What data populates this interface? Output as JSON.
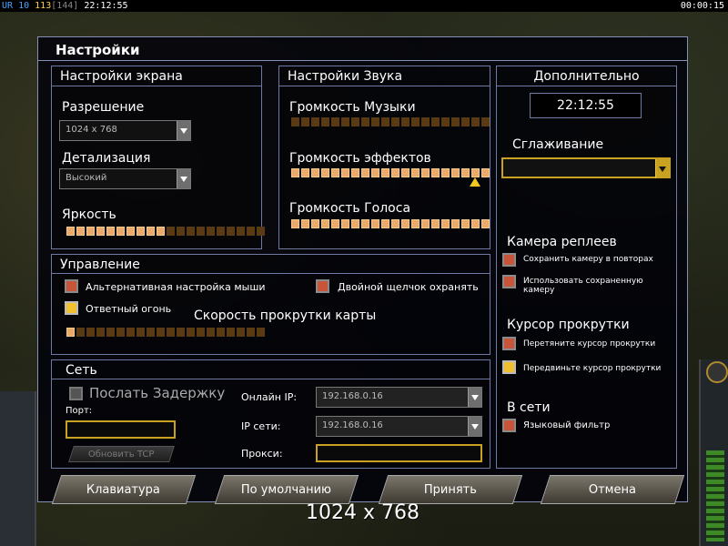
{
  "hud": {
    "faction": "UR",
    "power": "10",
    "money": "113",
    "money_extra": "[144]",
    "time": "22:12:55",
    "timer": "00:00:15"
  },
  "dialog": {
    "title": "Настройки"
  },
  "screen": {
    "header": "Настройки экрана",
    "resolution_label": "Разрешение",
    "resolution_value": "1024 x 768",
    "detail_label": "Детализация",
    "detail_value": "Высокий",
    "brightness_label": "Яркость",
    "brightness_level": 0.5
  },
  "sound": {
    "header": "Настройки Звука",
    "music_label": "Громкость Музыки",
    "music_level": 0,
    "effects_label": "Громкость эффектов",
    "effects_level": 1.0,
    "voice_label": "Громкость Голоса",
    "voice_level": 1.0
  },
  "extra": {
    "header": "Дополнительно",
    "clock": "22:12:55",
    "antialias_label": "Сглаживание",
    "antialias_value": "",
    "replay_camera_header": "Камера реплеев",
    "save_camera": "Сохранить камеру в повторах",
    "use_saved_camera": "Использовать сохраненную камеру",
    "scroll_cursor_header": "Курсор прокрутки",
    "drag_cursor": "Перетяните курсор прокрутки",
    "move_cursor": "Передвиньте курсор прокрутки",
    "online_header": "В сети",
    "language_filter": "Языковый фильтр"
  },
  "control": {
    "header": "Управление",
    "alt_mouse": "Альтернативная настройка мыши",
    "double_click": "Двойной щелчок охранять",
    "return_fire": "Ответный огонь",
    "scroll_speed_label": "Скорость прокрутки карты",
    "scroll_speed_level": 0.05
  },
  "network": {
    "header": "Сеть",
    "send_delay": "Послать Задержку",
    "port_label": "Порт:",
    "port_value": "",
    "refresh_button": "Обновить TCP",
    "online_ip_label": "Онлайн IP:",
    "online_ip_value": "192.168.0.16",
    "lan_ip_label": "IP сети:",
    "lan_ip_value": "192.168.0.16",
    "proxy_label": "Прокси:",
    "proxy_value": ""
  },
  "buttons": {
    "keyboard": "Клавиатура",
    "defaults": "По умолчанию",
    "apply": "Принять",
    "cancel": "Отмена"
  },
  "caption": "1024 x 768",
  "colors": {
    "panel_border": "#6e79a6",
    "slider_on": "#eba96a",
    "slider_off": "#5a3a12",
    "gold": "#c8a220"
  }
}
